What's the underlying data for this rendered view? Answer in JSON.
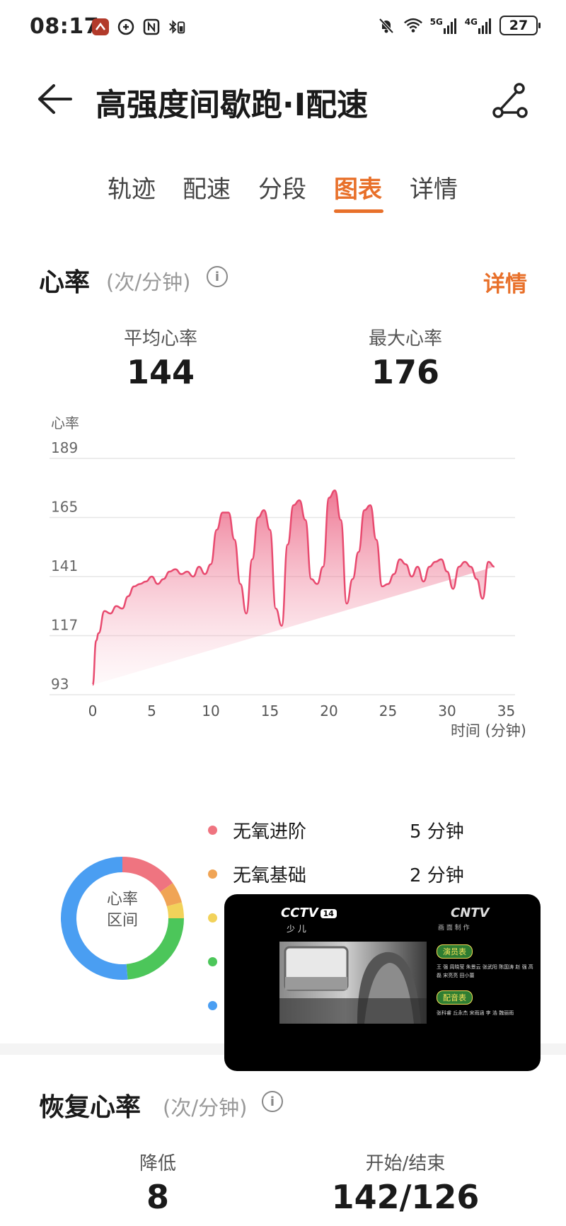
{
  "status_bar": {
    "time": "08:17",
    "net_5g": "5G",
    "net_4g": "4G",
    "battery": "27"
  },
  "header": {
    "title": "高强度间歇跑·I配速"
  },
  "tabs": [
    {
      "label": "轨迹"
    },
    {
      "label": "配速"
    },
    {
      "label": "分段"
    },
    {
      "label": "图表"
    },
    {
      "label": "详情"
    }
  ],
  "heart_rate": {
    "title": "心率",
    "unit": "(次/分钟)",
    "detail_link": "详情",
    "avg_label": "平均心率",
    "avg_value": "144",
    "max_label": "最大心率",
    "max_value": "176"
  },
  "chart_data": {
    "type": "area",
    "ylabel": "心率",
    "xlabel": "时间 (分钟)",
    "ylim": [
      93,
      189
    ],
    "xlim": [
      0,
      36
    ],
    "yticks": [
      "189",
      "165",
      "141",
      "117",
      "93"
    ],
    "xticks": [
      "0",
      "5",
      "10",
      "15",
      "20",
      "25",
      "30",
      "35"
    ],
    "line_color": "#e84a6f",
    "x": [
      0,
      0.3,
      0.5,
      1,
      1.5,
      2,
      2.5,
      3,
      3.5,
      4,
      4.5,
      5,
      5.5,
      6,
      6.5,
      7,
      7.5,
      8,
      8.5,
      9,
      9.5,
      10,
      10.5,
      11,
      11.5,
      12,
      12.5,
      13,
      13.5,
      14,
      14.5,
      15,
      15.5,
      16,
      16.5,
      17,
      17.5,
      18,
      18.5,
      19,
      19.5,
      20,
      20.5,
      21,
      21.5,
      22,
      22.5,
      23,
      23.5,
      24,
      24.5,
      25,
      25.5,
      26,
      26.5,
      27,
      27.5,
      28,
      28.5,
      29,
      29.5,
      30,
      30.5,
      31,
      31.5,
      32,
      32.5,
      33,
      33.5,
      34,
      34.5,
      35,
      35.5,
      36
    ],
    "y": [
      97,
      115,
      118,
      127,
      126,
      129,
      128,
      133,
      137,
      138,
      139,
      141,
      138,
      140,
      143,
      144,
      142,
      143,
      141,
      145,
      142,
      146,
      160,
      167,
      167,
      156,
      138,
      126,
      148,
      165,
      168,
      160,
      128,
      121,
      154,
      170,
      172,
      164,
      140,
      138,
      145,
      173,
      176,
      164,
      130,
      140,
      151,
      168,
      170,
      156,
      137,
      138,
      142,
      148,
      146,
      141,
      145,
      139,
      145,
      147,
      148,
      143,
      136,
      145,
      147,
      145,
      140,
      132,
      147,
      145
    ]
  },
  "zones": {
    "center_line1": "心率",
    "center_line2": "区间",
    "items": [
      {
        "name": "无氧进阶",
        "duration": "5 分钟",
        "color": "#ef7480"
      },
      {
        "name": "无氧基础",
        "duration": "2 分钟",
        "color": "#f0a455"
      },
      {
        "name": "",
        "duration": "",
        "color": "#f2d25a"
      },
      {
        "name": "",
        "duration": "",
        "color": "#4cc65a"
      },
      {
        "name": "",
        "duration": "",
        "color": "#4a9ef2"
      }
    ]
  },
  "pip": {
    "logo": "CCTV",
    "channel": "14",
    "sub": "少 儿",
    "cntv": "CNTV",
    "cntv_sub": "画 面 制 作",
    "tag1": "演员表",
    "tag2": "配音表",
    "names1": "王 强 周晓莹 朱景云 张武阳 陈国涛 赵 强 高 磊 宋亮亮 田小蕾",
    "names2": "张科睿 丘永杰 宋雨涵 李 浩 魏丽雨"
  },
  "recovery": {
    "title": "恢复心率",
    "unit": "(次/分钟)",
    "drop_label": "降低",
    "drop_value": "8",
    "range_label": "开始/结束",
    "range_value": "142/126"
  }
}
